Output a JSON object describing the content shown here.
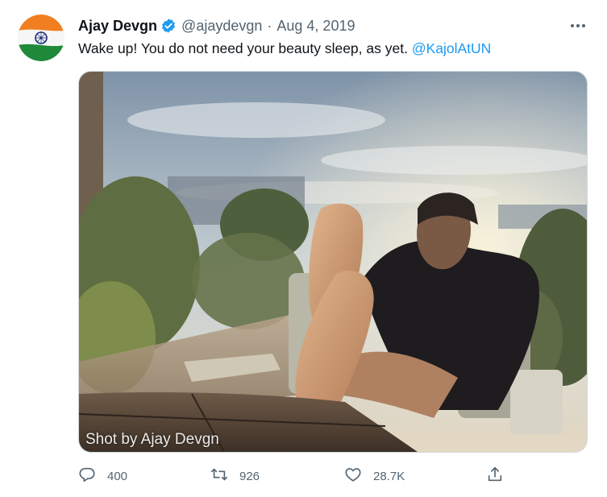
{
  "tweet": {
    "author_name": "Ajay Devgn",
    "handle": "@ajaydevgn",
    "separator": "·",
    "date": "Aug 4, 2019",
    "text_before": "Wake up! You do not need your beauty sleep, as yet. ",
    "mention": "@KajolAtUN",
    "watermark": "Shot by Ajay Devgn",
    "verified": true
  },
  "actions": {
    "reply_count": "400",
    "retweet_count": "926",
    "like_count": "28.7K"
  },
  "icons": {
    "verified": "verified-badge-icon",
    "more": "more-dots-icon",
    "reply": "reply-icon",
    "retweet": "retweet-icon",
    "like": "heart-icon",
    "share": "share-icon"
  },
  "colors": {
    "link": "#1d9bf0",
    "secondary_text": "#536471",
    "primary_text": "#0f1419"
  }
}
